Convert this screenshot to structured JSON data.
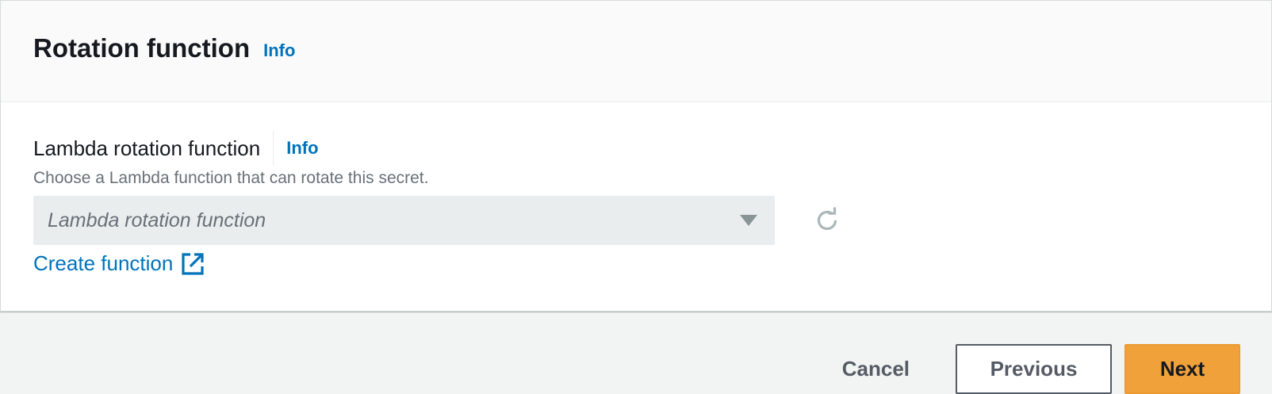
{
  "section": {
    "title": "Rotation function",
    "info_label": "Info"
  },
  "field": {
    "label": "Lambda rotation function",
    "info_label": "Info",
    "description": "Choose a Lambda function that can rotate this secret.",
    "select_placeholder": "Lambda rotation function",
    "create_link": "Create function"
  },
  "actions": {
    "cancel": "Cancel",
    "previous": "Previous",
    "next": "Next"
  },
  "icons": {
    "select_caret": "caret-down-icon",
    "refresh": "refresh-icon",
    "external": "external-link-icon"
  },
  "colors": {
    "link": "#0073bb",
    "primary_button": "#f0a13a",
    "disabled_select": "#eaeded",
    "page_background": "#f2f3f3"
  }
}
